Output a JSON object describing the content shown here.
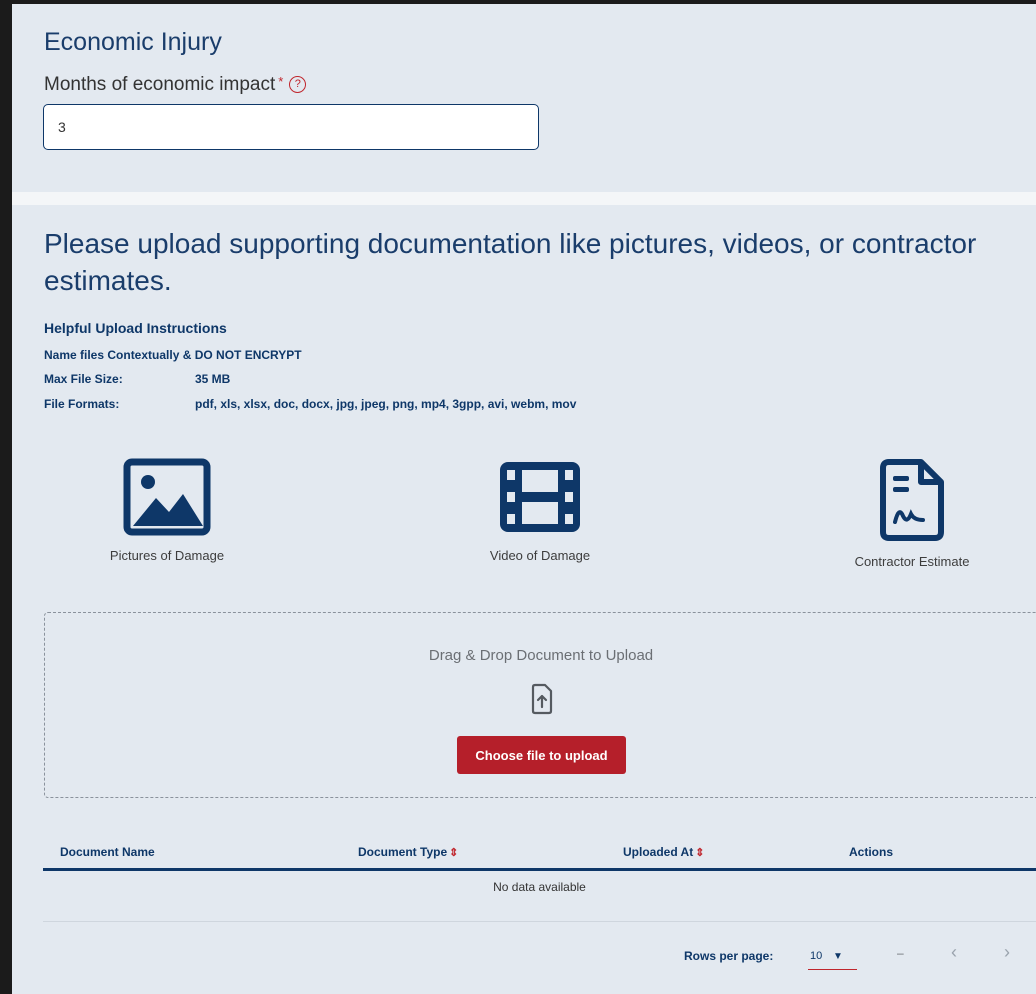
{
  "economic_injury": {
    "title": "Economic Injury",
    "months_label": "Months of economic impact",
    "required_mark": "*",
    "help_icon": "question-circle-icon",
    "months_value": "3"
  },
  "upload": {
    "heading": "Please upload supporting documentation like pictures, videos, or contractor estimates.",
    "instructions_title": "Helpful Upload Instructions",
    "name_files_label": "Name files Contextually &",
    "name_files_strong": "DO NOT ENCRYPT",
    "max_size_label": "Max File Size:",
    "max_size_value": "35 MB",
    "formats_label": "File Formats:",
    "formats_value": "pdf, xls, xlsx, doc, docx, jpg, jpeg, png, mp4, 3gpp, avi, webm, mov",
    "categories": [
      {
        "label": "Pictures of Damage",
        "icon": "image-icon"
      },
      {
        "label": "Video of Damage",
        "icon": "film-icon"
      },
      {
        "label": "Contractor Estimate",
        "icon": "signed-document-icon"
      }
    ],
    "dropzone_text": "Drag & Drop Document to Upload",
    "dropzone_icon": "file-upload-icon",
    "choose_button": "Choose file to upload"
  },
  "table": {
    "columns": [
      "Document Name",
      "Document Type",
      "Uploaded At",
      "Actions"
    ],
    "sort_icon": "sort-icon",
    "empty_text": "No data available",
    "rows_per_page_label": "Rows per page:",
    "rows_per_page_value": "10",
    "range_text": "–"
  },
  "colors": {
    "navy": "#0e3768",
    "accent_red": "#b51f2a",
    "panel_bg": "#e3e9f0"
  }
}
